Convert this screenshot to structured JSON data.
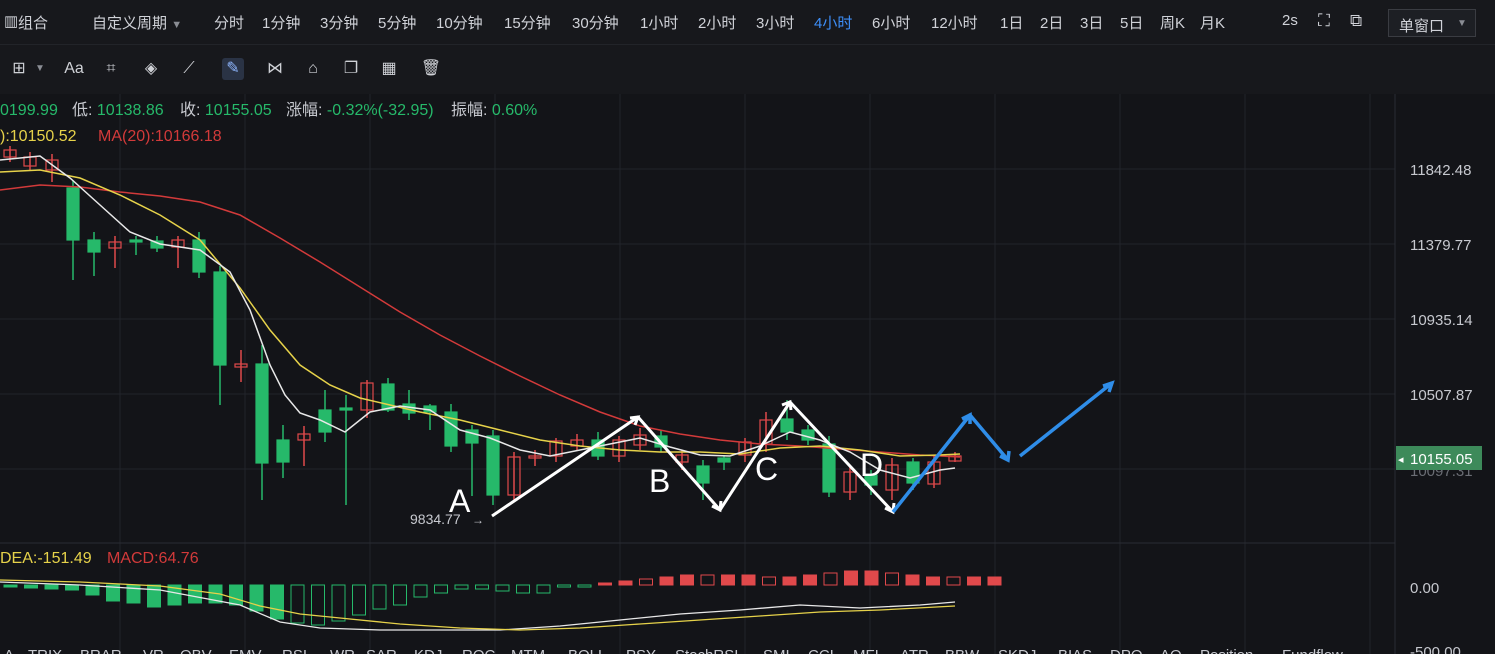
{
  "topbar": {
    "combo_label": "组合",
    "custom_period": "自定义周期",
    "periods": [
      "分时",
      "1分钟",
      "3分钟",
      "5分钟",
      "10分钟",
      "15分钟",
      "30分钟",
      "1小时",
      "2小时",
      "3小时",
      "4小时",
      "6小时",
      "12小时",
      "1日",
      "2日",
      "3日",
      "5日",
      "周K",
      "月K"
    ],
    "active_period": "4小时",
    "refresh": "2s",
    "window_mode": "单窗口"
  },
  "toolbar": {
    "tools": [
      "crosshair-icon",
      "text-icon",
      "fib-icon",
      "eraser-icon",
      "ruler-icon",
      "pen-icon",
      "wave-icon",
      "lock-icon",
      "copy-icon",
      "image-icon",
      "trash-icon"
    ],
    "text_tool_label": "Aa",
    "selected_index": 5
  },
  "info": {
    "high_fragment": "0199.99",
    "low_label": "低:",
    "low": "10138.86",
    "close_label": "收:",
    "close": "10155.05",
    "change_label": "涨幅:",
    "change": "-0.32%(-32.95)",
    "amp_label": "振幅:",
    "amp": "0.60%",
    "ma_fragment": "):10150.52",
    "ma20": "MA(20):10166.18"
  },
  "macd_info": {
    "dea": "DEA:-151.49",
    "macd": "MACD:64.76"
  },
  "indicators": [
    "A",
    "TRIX",
    "BRAR",
    "VR",
    "OBV",
    "EMV",
    "RSI",
    "WR",
    "SAR",
    "KDJ",
    "ROC",
    "MTM",
    "BOLL",
    "PSY",
    "StochRSI",
    "SMI",
    "CCI",
    "MFI",
    "ATR",
    "BBW",
    "SKDJ",
    "BIAS",
    "DPO",
    "AO",
    "Position",
    "Fundflow"
  ],
  "chart_data": {
    "type": "candlestick",
    "price_ticks": [
      "11842.48",
      "11379.77",
      "10935.14",
      "10507.87"
    ],
    "current_price": "10155.05",
    "hidden_price": "10097.31",
    "low_annotation": "9834.77",
    "macd_ticks": [
      "0.00",
      "-500.00"
    ],
    "wave_labels": [
      "A",
      "B",
      "C",
      "D"
    ],
    "colors": {
      "up": "#26b96a",
      "down": "#e0494b",
      "ma_short": "#e8e8e8",
      "ma_mid": "#e6d24a",
      "ma_long": "#d23a3a",
      "arrow": "#2f8de8",
      "grid": "#22242a"
    }
  }
}
